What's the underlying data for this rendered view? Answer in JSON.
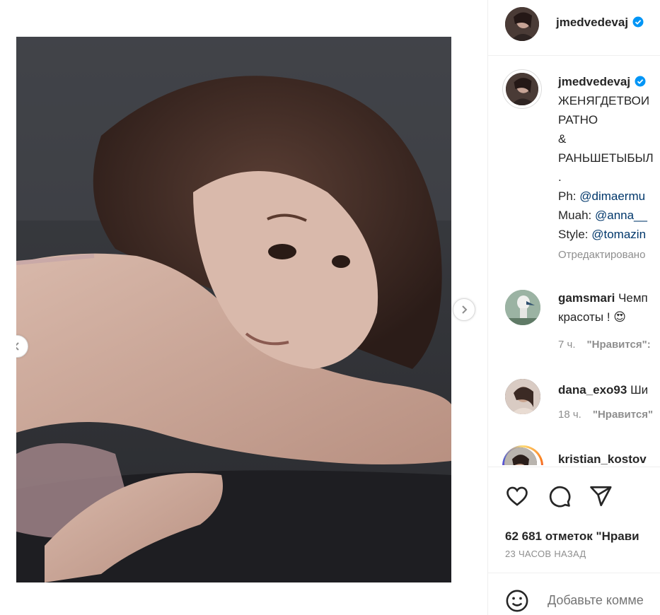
{
  "post": {
    "author": "jmedvedevaj",
    "verified": true,
    "caption_lines": [
      "ЖЕНЯГДЕТВОИ",
      "РАТНО",
      "&",
      "РАНЬШЕТЫБЫЛ",
      "."
    ],
    "credits": [
      {
        "label": "Ph: ",
        "mention": "@dimaermu"
      },
      {
        "label": "Muah: ",
        "mention": "@anna__"
      },
      {
        "label": "Style: ",
        "mention": "@tomazin"
      }
    ],
    "edited_label": "Отредактировано"
  },
  "comments": [
    {
      "user": "gamsmari",
      "text": "Чемп",
      "text_line2": "красоты ! 😍",
      "time": "7 ч.",
      "like_label": "\"Нравится\":"
    },
    {
      "user": "dana_exo93",
      "text": "Ши",
      "time": "18 ч.",
      "like_label": "\"Нравится\""
    },
    {
      "user": "kristian_kostov",
      "text": ""
    }
  ],
  "engagement": {
    "likes_text": "62 681 отметок \"Нрави",
    "time_ago": "23 ЧАСОВ НАЗАД"
  },
  "add_comment": {
    "placeholder": "Добавьте комме"
  },
  "colors": {
    "verified": "#0095f6",
    "mention": "#00376b",
    "muted": "#8e8e8e",
    "border": "#efefef"
  },
  "icons": {
    "like": "heart-icon",
    "comment": "comment-bubble-icon",
    "share": "paper-plane-icon",
    "emoji": "smiley-icon",
    "prev": "chevron-left-icon",
    "next": "chevron-right-icon",
    "verified": "verified-badge-icon"
  }
}
